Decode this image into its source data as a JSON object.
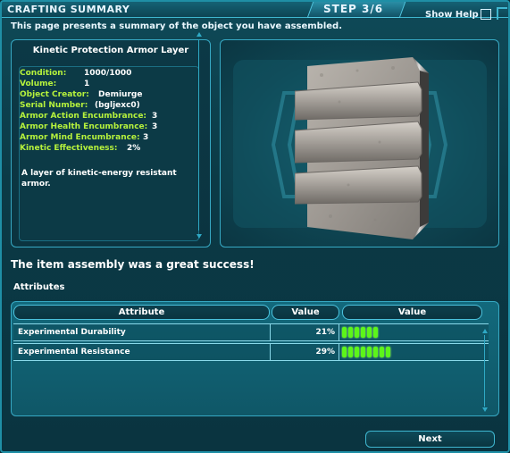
{
  "window": {
    "title": "CRAFTING SUMMARY",
    "step": "STEP 3/6",
    "show_help": "Show Help"
  },
  "subtitle": "This page presents a summary of the object you have assembled.",
  "object": {
    "name": "Kinetic Protection Armor Layer",
    "properties": [
      {
        "key": "Condition:",
        "value": "1000/1000"
      },
      {
        "key": "Volume:",
        "value": "1"
      },
      {
        "key": "Object Creator:",
        "value": "Demiurge"
      },
      {
        "key": "Serial Number:",
        "value": "(bgljexc0)"
      },
      {
        "key": "Armor Action Encumbrance:",
        "value": "3"
      },
      {
        "key": "Armor Health Encumbrance:",
        "value": "3"
      },
      {
        "key": "Armor Mind Encumbrance:",
        "value": "3"
      },
      {
        "key": "Kinetic Effectiveness:",
        "value": "2%"
      }
    ],
    "description": "A layer of kinetic-energy resistant armor."
  },
  "result_message": "The item assembly was a great success!",
  "attributes": {
    "section_label": "Attributes",
    "headers": [
      "Attribute",
      "Value",
      "Value"
    ],
    "rows": [
      {
        "name": "Experimental Durability",
        "value": "21%",
        "bar_segments": 6
      },
      {
        "name": "Experimental Resistance",
        "value": "29%",
        "bar_segments": 8
      }
    ]
  },
  "buttons": {
    "next": "Next"
  },
  "colors": {
    "accent": "#37a9c4",
    "label_green": "#b6f23c",
    "bar_green": "#5cf51a"
  }
}
